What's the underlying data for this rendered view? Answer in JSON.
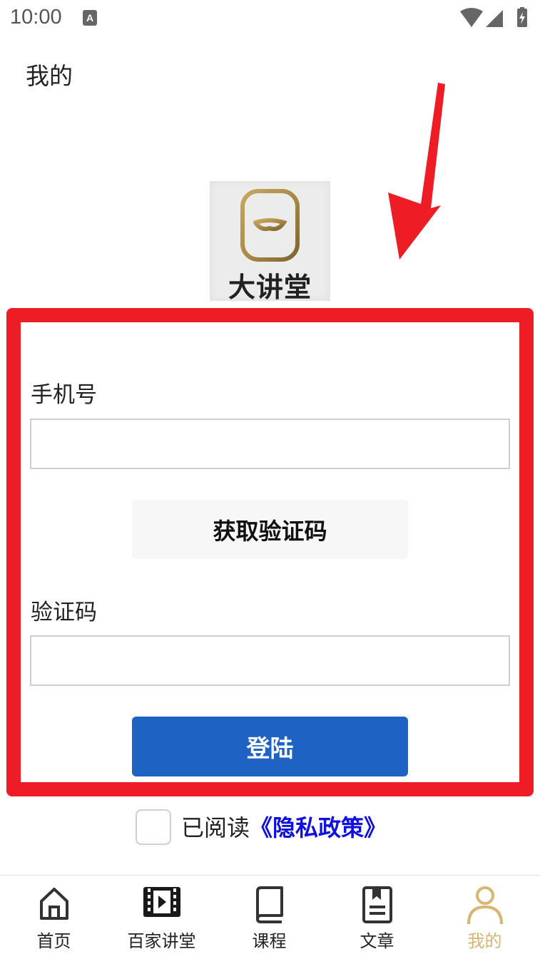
{
  "status_bar": {
    "time": "10:00",
    "notification_letter": "A"
  },
  "header": {
    "title": "我的"
  },
  "logo": {
    "text": "大讲堂"
  },
  "form": {
    "phone_label": "手机号",
    "phone_value": "",
    "get_code_label": "获取验证码",
    "code_label": "验证码",
    "code_value": "",
    "login_label": "登陆"
  },
  "agreement": {
    "prefix": "已阅读",
    "link": "《隐私政策》",
    "checked": false
  },
  "bottom_nav": {
    "items": [
      {
        "label": "首页",
        "icon": "home-icon"
      },
      {
        "label": "百家讲堂",
        "icon": "video-icon"
      },
      {
        "label": "课程",
        "icon": "book-icon"
      },
      {
        "label": "文章",
        "icon": "article-icon"
      },
      {
        "label": "我的",
        "icon": "person-icon",
        "active": true
      }
    ]
  },
  "colors": {
    "annotation_red": "#ee1c25",
    "primary_blue": "#1e63c4",
    "active_gold": "#d8b570",
    "link_blue": "#1010e0"
  }
}
